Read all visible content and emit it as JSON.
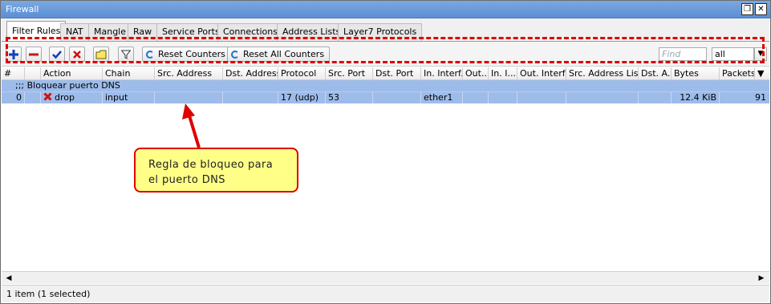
{
  "window": {
    "title": "Firewall",
    "restore_glyph": "❐",
    "close_glyph": "✕"
  },
  "tabs": [
    {
      "label": "Filter Rules"
    },
    {
      "label": "NAT"
    },
    {
      "label": "Mangle"
    },
    {
      "label": "Raw"
    },
    {
      "label": "Service Ports"
    },
    {
      "label": "Connections"
    },
    {
      "label": "Address Lists"
    },
    {
      "label": "Layer7 Protocols"
    }
  ],
  "toolbar": {
    "reset_counters": "Reset Counters",
    "reset_all_counters": "Reset All Counters",
    "find_placeholder": "Find",
    "filter_value": "all"
  },
  "columns": [
    "#",
    "",
    "Action",
    "Chain",
    "Src. Address",
    "Dst. Address",
    "Protocol",
    "Src. Port",
    "Dst. Port",
    "In. Interf...",
    "Out...",
    "In. I...",
    "Out. Interf...",
    "Src. Address List",
    "Dst. A...",
    "Bytes",
    "Packets"
  ],
  "comment_row": {
    "text": ";;; Bloquear puerto DNS"
  },
  "rule": {
    "num": "0",
    "action": "drop",
    "chain": "input",
    "src_address": "",
    "dst_address": "",
    "protocol": "17 (udp)",
    "src_port": "53",
    "dst_port": "",
    "in_interface": "ether1",
    "out": "",
    "in_i": "",
    "out_interface": "",
    "src_address_list": "",
    "dst_a": "",
    "bytes": "12.4 KiB",
    "packets": "91"
  },
  "callout": {
    "line1": "Regla de bloqueo para",
    "line2": "el puerto DNS"
  },
  "status": {
    "text": "1 item (1 selected)"
  },
  "colors": {
    "selection": "#9dbcea",
    "annotation_red": "#e00000",
    "callout_fill": "#ffff88",
    "titlebar": "#6a9bdc"
  }
}
